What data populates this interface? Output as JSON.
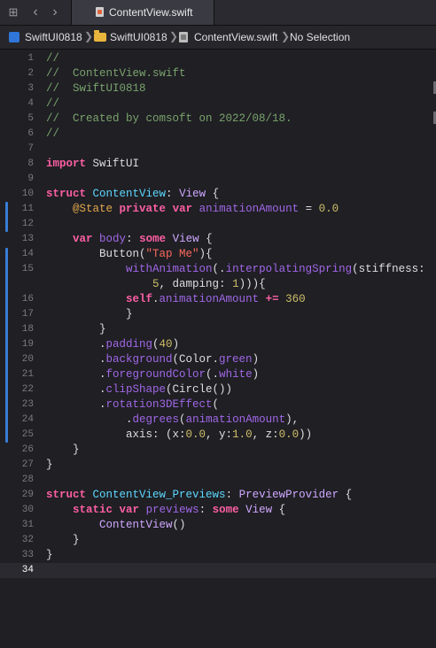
{
  "toolbar": {
    "grid_icon": "grid-icon",
    "back_icon": "chevron-left-icon",
    "forward_icon": "chevron-right-icon"
  },
  "tab": {
    "label": "ContentView.swift"
  },
  "jumpbar": {
    "project": "SwiftUI0818",
    "group": "SwiftUI0818",
    "file": "ContentView.swift",
    "selection": "No Selection"
  },
  "editor": {
    "current_line": 34,
    "lines": [
      {
        "n": "1",
        "tokens": [
          [
            "cm",
            "//"
          ]
        ]
      },
      {
        "n": "2",
        "tokens": [
          [
            "cm",
            "//  ContentView.swift"
          ]
        ]
      },
      {
        "n": "3",
        "tokens": [
          [
            "cm",
            "//  SwiftUI0818"
          ]
        ]
      },
      {
        "n": "4",
        "tokens": [
          [
            "cm",
            "//"
          ]
        ]
      },
      {
        "n": "5",
        "tokens": [
          [
            "cm",
            "//  Created by comsoft on 2022/08/18."
          ]
        ]
      },
      {
        "n": "6",
        "tokens": [
          [
            "cm",
            "//"
          ]
        ]
      },
      {
        "n": "7",
        "tokens": []
      },
      {
        "n": "8",
        "tokens": [
          [
            "kw",
            "import"
          ],
          [
            "pl",
            " SwiftUI"
          ]
        ]
      },
      {
        "n": "9",
        "tokens": []
      },
      {
        "n": "10",
        "tokens": [
          [
            "kw",
            "struct"
          ],
          [
            "pl",
            " "
          ],
          [
            "tyd",
            "ContentView"
          ],
          [
            "pl",
            ": "
          ],
          [
            "ty",
            "View"
          ],
          [
            "pl",
            " {"
          ]
        ]
      },
      {
        "n": "11",
        "tokens": [
          [
            "pl",
            "    "
          ],
          [
            "attr",
            "@State"
          ],
          [
            "pl",
            " "
          ],
          [
            "kw",
            "private"
          ],
          [
            "pl",
            " "
          ],
          [
            "kw",
            "var"
          ],
          [
            "pl",
            " "
          ],
          [
            "prop",
            "animationAmount"
          ],
          [
            "pl",
            " = "
          ],
          [
            "num",
            "0.0"
          ]
        ]
      },
      {
        "n": "12",
        "tokens": []
      },
      {
        "n": "13",
        "tokens": [
          [
            "pl",
            "    "
          ],
          [
            "kw",
            "var"
          ],
          [
            "pl",
            " "
          ],
          [
            "prop",
            "body"
          ],
          [
            "pl",
            ": "
          ],
          [
            "kw",
            "some"
          ],
          [
            "pl",
            " "
          ],
          [
            "ty",
            "View"
          ],
          [
            "pl",
            " {"
          ]
        ]
      },
      {
        "n": "14",
        "tokens": [
          [
            "pl",
            "        Button("
          ],
          [
            "str",
            "\"Tap Me\""
          ],
          [
            "pl",
            "){"
          ]
        ]
      },
      {
        "n": "15",
        "tokens": [
          [
            "pl",
            "            "
          ],
          [
            "fn",
            "withAnimation"
          ],
          [
            "pl",
            "(."
          ],
          [
            "fn",
            "interpolatingSpring"
          ],
          [
            "pl",
            "(stiffness:"
          ]
        ]
      },
      {
        "n": "",
        "tokens": [
          [
            "pl",
            "                "
          ],
          [
            "num",
            "5"
          ],
          [
            "pl",
            ", damping: "
          ],
          [
            "num",
            "1"
          ],
          [
            "pl",
            "))){"
          ]
        ]
      },
      {
        "n": "16",
        "tokens": [
          [
            "pl",
            "            "
          ],
          [
            "kw",
            "self"
          ],
          [
            "pl",
            "."
          ],
          [
            "prop",
            "animationAmount"
          ],
          [
            "pl",
            " "
          ],
          [
            "kw",
            "+="
          ],
          [
            "pl",
            " "
          ],
          [
            "num",
            "360"
          ]
        ]
      },
      {
        "n": "17",
        "tokens": [
          [
            "pl",
            "            }"
          ]
        ]
      },
      {
        "n": "18",
        "tokens": [
          [
            "pl",
            "        }"
          ]
        ]
      },
      {
        "n": "19",
        "tokens": [
          [
            "pl",
            "        ."
          ],
          [
            "fn",
            "padding"
          ],
          [
            "pl",
            "("
          ],
          [
            "num",
            "40"
          ],
          [
            "pl",
            ")"
          ]
        ]
      },
      {
        "n": "20",
        "tokens": [
          [
            "pl",
            "        ."
          ],
          [
            "fn",
            "background"
          ],
          [
            "pl",
            "(Color."
          ],
          [
            "prop",
            "green"
          ],
          [
            "pl",
            ")"
          ]
        ]
      },
      {
        "n": "21",
        "tokens": [
          [
            "pl",
            "        ."
          ],
          [
            "fn",
            "foregroundColor"
          ],
          [
            "pl",
            "(."
          ],
          [
            "prop",
            "white"
          ],
          [
            "pl",
            ")"
          ]
        ]
      },
      {
        "n": "22",
        "tokens": [
          [
            "pl",
            "        ."
          ],
          [
            "fn",
            "clipShape"
          ],
          [
            "pl",
            "(Circle())"
          ]
        ]
      },
      {
        "n": "23",
        "tokens": [
          [
            "pl",
            "        ."
          ],
          [
            "fn",
            "rotation3DEffect"
          ],
          [
            "pl",
            "("
          ]
        ]
      },
      {
        "n": "24",
        "tokens": [
          [
            "pl",
            "            ."
          ],
          [
            "fn",
            "degrees"
          ],
          [
            "pl",
            "("
          ],
          [
            "prop",
            "animationAmount"
          ],
          [
            "pl",
            "),"
          ]
        ]
      },
      {
        "n": "25",
        "tokens": [
          [
            "pl",
            "            axis: (x:"
          ],
          [
            "num",
            "0.0"
          ],
          [
            "pl",
            ", y:"
          ],
          [
            "num",
            "1.0"
          ],
          [
            "pl",
            ", z:"
          ],
          [
            "num",
            "0.0"
          ],
          [
            "pl",
            "))"
          ]
        ]
      },
      {
        "n": "26",
        "tokens": [
          [
            "pl",
            "    }"
          ]
        ]
      },
      {
        "n": "27",
        "tokens": [
          [
            "pl",
            "}"
          ]
        ]
      },
      {
        "n": "28",
        "tokens": []
      },
      {
        "n": "29",
        "tokens": [
          [
            "kw",
            "struct"
          ],
          [
            "pl",
            " "
          ],
          [
            "tyd",
            "ContentView_Previews"
          ],
          [
            "pl",
            ": "
          ],
          [
            "ty",
            "PreviewProvider"
          ],
          [
            "pl",
            " {"
          ]
        ]
      },
      {
        "n": "30",
        "tokens": [
          [
            "pl",
            "    "
          ],
          [
            "kw",
            "static"
          ],
          [
            "pl",
            " "
          ],
          [
            "kw",
            "var"
          ],
          [
            "pl",
            " "
          ],
          [
            "prop",
            "previews"
          ],
          [
            "pl",
            ": "
          ],
          [
            "kw",
            "some"
          ],
          [
            "pl",
            " "
          ],
          [
            "ty",
            "View"
          ],
          [
            "pl",
            " {"
          ]
        ]
      },
      {
        "n": "31",
        "tokens": [
          [
            "pl",
            "        "
          ],
          [
            "ty",
            "ContentView"
          ],
          [
            "pl",
            "()"
          ]
        ]
      },
      {
        "n": "32",
        "tokens": [
          [
            "pl",
            "    }"
          ]
        ]
      },
      {
        "n": "33",
        "tokens": [
          [
            "pl",
            "}"
          ]
        ]
      },
      {
        "n": "34",
        "tokens": []
      }
    ]
  }
}
